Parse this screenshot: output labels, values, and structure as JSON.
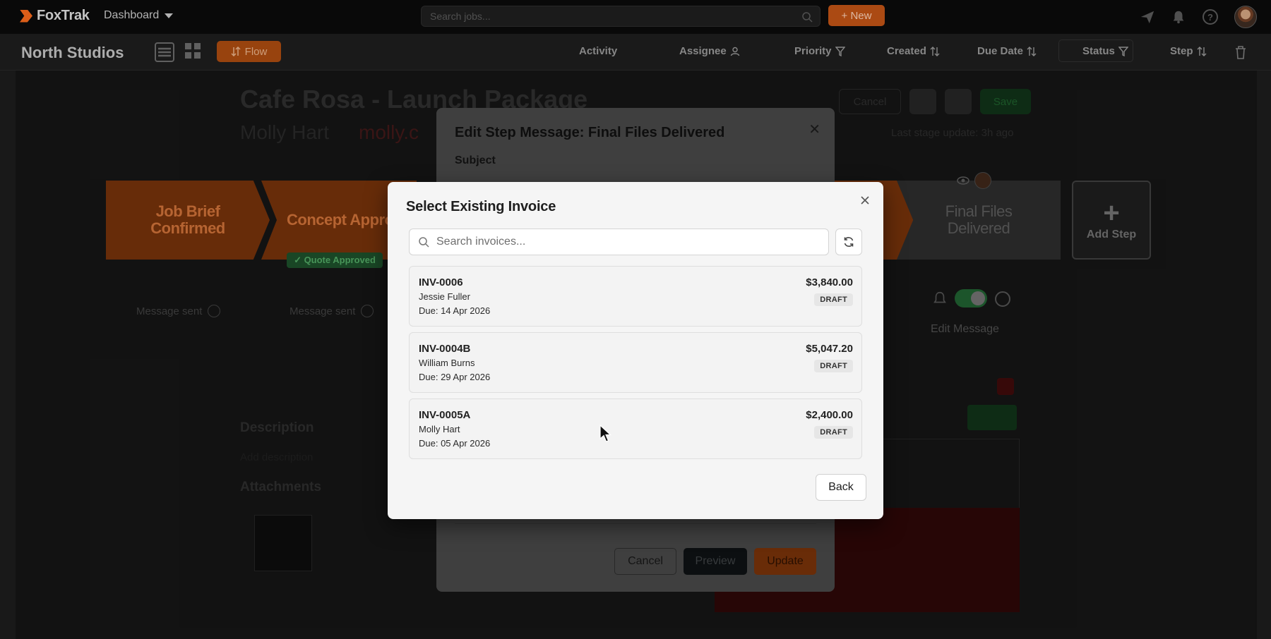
{
  "app": {
    "brand": "FoxTrak",
    "nav_dashboard": "Dashboard",
    "search_placeholder": "Search jobs...",
    "new_label": "+ New",
    "accent_color": "#e8641b"
  },
  "subbar": {
    "studio": "North Studios",
    "flow_label": "Flow",
    "filters": {
      "activity": "Activity",
      "assignee": "Assignee",
      "priority": "Priority",
      "created": "Created",
      "due_date": "Due Date",
      "status": "Status",
      "step": "Step"
    }
  },
  "job": {
    "title": "Cafe Rosa - Launch Package",
    "client": "Molly Hart",
    "email_fragment": "molly.c",
    "cancel_label": "Cancel",
    "save_label": "Save",
    "last_update": "Last stage update: 3h ago",
    "steps": {
      "s1_line1": "Job Brief",
      "s1_line2": "Confirmed",
      "s2": "Concept Approv",
      "final_line1": "Final Files",
      "final_line2": "Delivered",
      "add_step": "Add Step",
      "add_plus": "+"
    },
    "quote_badge": "✓ Quote Approved",
    "message_sent": "Message sent",
    "edit_message": "Edit Message",
    "description": "Description",
    "add_description": "Add description",
    "attachments": "Attachments"
  },
  "edit_modal": {
    "title": "Edit Step Message: Final Files Delivered",
    "subject_label": "Subject",
    "cancel": "Cancel",
    "preview": "Preview",
    "update": "Update"
  },
  "invoice_modal": {
    "title": "Select Existing Invoice",
    "search_placeholder": "Search invoices...",
    "back": "Back",
    "invoices": [
      {
        "number": "INV-0006",
        "client": "Jessie Fuller",
        "due": "Due: 14 Apr 2026",
        "amount": "$3,840.00",
        "status": "DRAFT"
      },
      {
        "number": "INV-0004B",
        "client": "William Burns",
        "due": "Due: 29 Apr 2026",
        "amount": "$5,047.20",
        "status": "DRAFT"
      },
      {
        "number": "INV-0005A",
        "client": "Molly Hart",
        "due": "Due: 05 Apr 2026",
        "amount": "$2,400.00",
        "status": "DRAFT"
      }
    ]
  }
}
